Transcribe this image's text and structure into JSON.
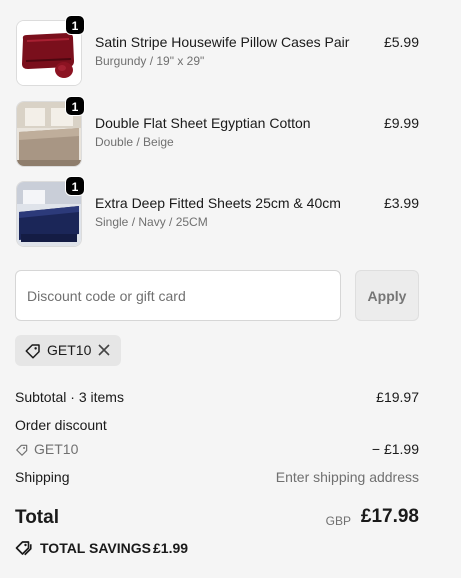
{
  "items": [
    {
      "name": "Satin Stripe Housewife Pillow Cases Pair",
      "variant": "Burgundy / 19\" x 29\"",
      "price": "£5.99",
      "quantity": "1",
      "image_icon": "burgundy-pillowcases-image"
    },
    {
      "name": "Double Flat Sheet Egyptian Cotton",
      "variant": "Double / Beige",
      "price": "£9.99",
      "quantity": "1",
      "image_icon": "beige-bedsheet-image"
    },
    {
      "name": "Extra Deep Fitted Sheets 25cm & 40cm",
      "variant": "Single / Navy / 25CM",
      "price": "£3.99",
      "quantity": "1",
      "image_icon": "navy-fitted-sheet-image"
    }
  ],
  "discount": {
    "placeholder": "Discount code or gift card",
    "value": "",
    "apply_label": "Apply",
    "applied_code": "GET10"
  },
  "summary": {
    "subtotal_label": "Subtotal · 3 items",
    "subtotal_value": "£19.97",
    "order_discount_label": "Order discount",
    "discount_code": "GET10",
    "discount_value": "− £1.99",
    "shipping_label": "Shipping",
    "shipping_value": "Enter shipping address",
    "total_label": "Total",
    "currency": "GBP",
    "total_value": "£17.98",
    "savings_label": "TOTAL SAVINGS",
    "savings_value": "£1.99"
  },
  "colors": {
    "background": "#f5f5f5",
    "text": "#1a1a1a",
    "muted": "#707070",
    "badge": "#000000"
  }
}
